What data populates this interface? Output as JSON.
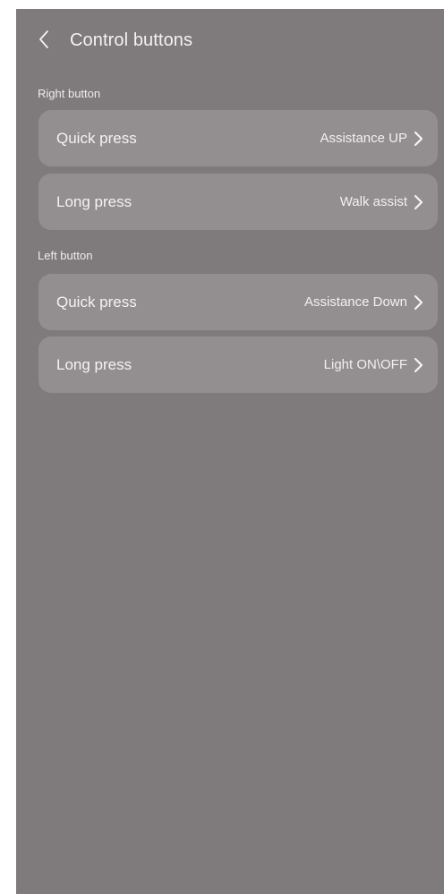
{
  "header": {
    "title": "Control buttons",
    "back_icon": "chevron-left-icon"
  },
  "sections": [
    {
      "label": "Right button",
      "rows": [
        {
          "label": "Quick press",
          "value": "Assistance UP"
        },
        {
          "label": "Long press",
          "value": "Walk assist"
        }
      ]
    },
    {
      "label": "Left button",
      "rows": [
        {
          "label": "Quick press",
          "value": "Assistance Down"
        },
        {
          "label": "Long press",
          "value": "Light ON\\OFF"
        }
      ]
    }
  ],
  "colors": {
    "background": "#7f7a7b",
    "row_background": "#938e8f",
    "text": "#f5f3f3"
  }
}
